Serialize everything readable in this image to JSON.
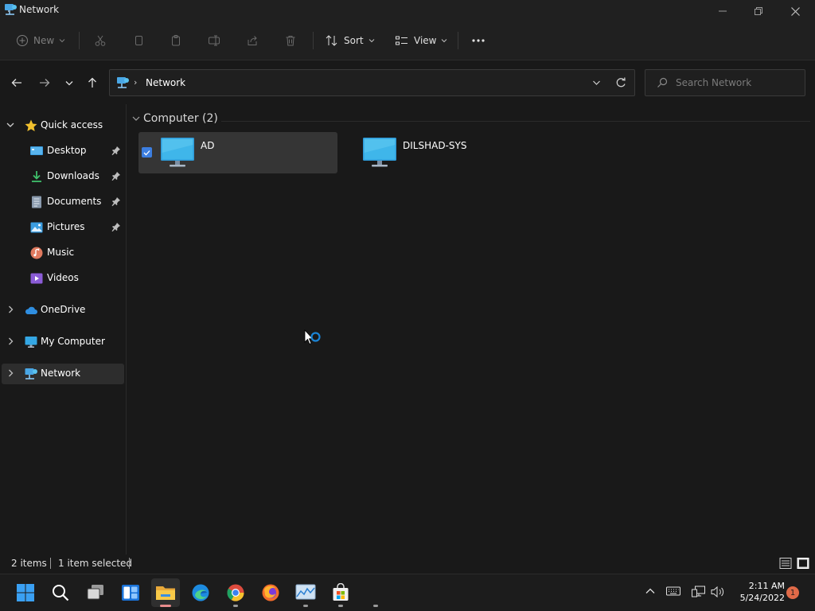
{
  "window": {
    "title": "Network"
  },
  "commandbar": {
    "new_label": "New",
    "sort_label": "Sort",
    "view_label": "View"
  },
  "address": {
    "crumb": "Network",
    "search_placeholder": "Search Network"
  },
  "sidebar": {
    "items": [
      {
        "label": "Quick access"
      },
      {
        "label": "Desktop"
      },
      {
        "label": "Downloads"
      },
      {
        "label": "Documents"
      },
      {
        "label": "Pictures"
      },
      {
        "label": "Music"
      },
      {
        "label": "Videos"
      },
      {
        "label": "OneDrive"
      },
      {
        "label": "My Computer"
      },
      {
        "label": "Network"
      }
    ]
  },
  "main": {
    "group_title": "Computer (2)",
    "items": [
      {
        "name": "AD",
        "selected": true
      },
      {
        "name": "DILSHAD-SYS",
        "selected": false
      }
    ]
  },
  "status": {
    "count": "2 items",
    "selection": "1 item selected"
  },
  "taskbar": {
    "time": "2:11 AM",
    "date": "5/24/2022",
    "notification_count": "1"
  },
  "colors": {
    "accent": "#3c7ee0",
    "background": "#191919",
    "chrome": "#202020"
  }
}
